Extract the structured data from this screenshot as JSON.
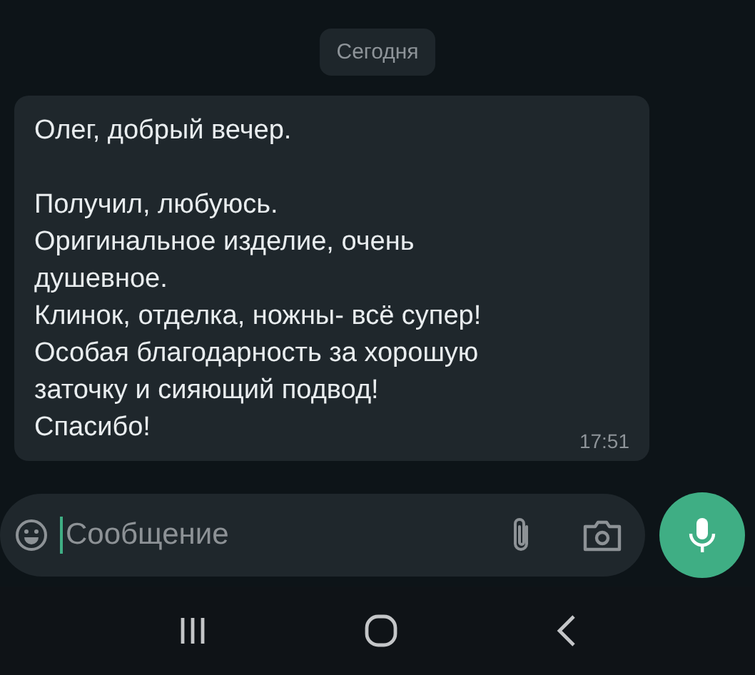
{
  "date_chip": "Сегодня",
  "message": {
    "text": "Олег, добрый вечер.\n\nПолучил, любуюсь.\nОригинальное изделие, очень\nдушевное.\nКлинок, отделка, ножны- всё супер!\nОсобая благодарность за хорошую\nзаточку и сияющий подвод!\nСпасибо!",
    "time": "17:51"
  },
  "composer": {
    "placeholder": "Сообщение"
  }
}
